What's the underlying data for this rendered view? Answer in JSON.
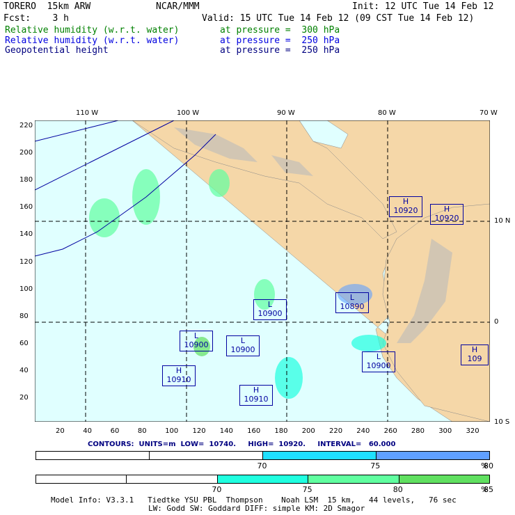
{
  "header": {
    "model": "TORERO  15km ARW",
    "org": "NCAR/MMM",
    "init": "Init: 12 UTC Tue 14 Feb 12",
    "fcst": "Fcst:    3 h",
    "valid": "Valid: 15 UTC Tue 14 Feb 12 (09 CST Tue 14 Feb 12)",
    "fields": [
      {
        "name": "Relative humidity (w.r.t. water)",
        "level": "at pressure =  300 hPa",
        "color": "#008000"
      },
      {
        "name": "Relative humidity (w.r.t. water)",
        "level": "at pressure =  250 hPa",
        "color": "#0000e0"
      },
      {
        "name": "Geopotential height",
        "level": "at pressure =  250 hPa",
        "color": "#000080"
      }
    ]
  },
  "map": {
    "lon_labels": [
      "110 W",
      "100 W",
      "90 W",
      "80 W",
      "70 W"
    ],
    "lat_labels": [
      "10 N",
      "0",
      "10 S"
    ],
    "x_ticks": [
      "20",
      "40",
      "60",
      "80",
      "100",
      "120",
      "140",
      "160",
      "180",
      "200",
      "220",
      "240",
      "260",
      "280",
      "300",
      "320"
    ],
    "y_ticks": [
      "20",
      "40",
      "60",
      "80",
      "100",
      "120",
      "140",
      "160",
      "180",
      "200",
      "220"
    ],
    "ocean_color": "#e0ffff",
    "land_color": "#f5d7a8",
    "centers": [
      {
        "type": "H",
        "value": "10920"
      },
      {
        "type": "H",
        "value": "10920"
      },
      {
        "type": "L",
        "value": "10900"
      },
      {
        "type": "L",
        "value": "10890"
      },
      {
        "type": "L",
        "value": "10900"
      },
      {
        "type": "L",
        "value": "10900"
      },
      {
        "type": "L",
        "value": "10900"
      },
      {
        "type": "H",
        "value": "10910"
      },
      {
        "type": "H",
        "value": "10910"
      },
      {
        "type": "H",
        "value": "109"
      }
    ]
  },
  "contours": "CONTOURS:  UNITS=m  LOW=  10740.     HIGH=  10920.     INTERVAL=   60.000",
  "legend_250": {
    "labels": [
      "70",
      "75",
      "80",
      "%"
    ],
    "colors": [
      "#ffffff",
      "#ffffff",
      "#20e0ff",
      "#60a0ff"
    ]
  },
  "legend_300": {
    "labels": [
      "70",
      "75",
      "80",
      "85",
      "%"
    ],
    "colors": [
      "#ffffff",
      "#ffffff",
      "#20ffe0",
      "#60ffa0",
      "#60e060"
    ]
  },
  "footer": {
    "line1": "Model Info: V3.3.1   Tiedtke YSU PBL  Thompson    Noah LSM  15 km,   44 levels,   76 sec",
    "line2": "LW: Godd SW: Goddard DIFF: simple KM: 2D Smagor"
  }
}
